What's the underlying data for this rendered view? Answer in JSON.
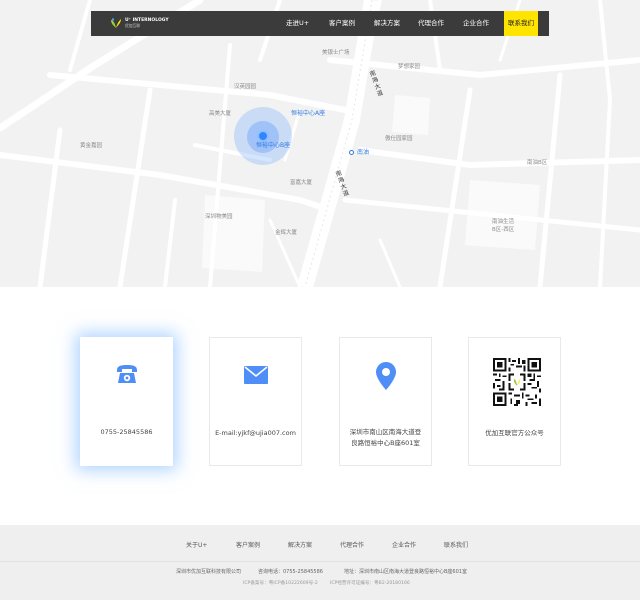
{
  "nav": {
    "logo_text": "U⁺ INTERNOLOGY",
    "logo_sub": "优加互联",
    "items": [
      {
        "label": "走进U+"
      },
      {
        "label": "客户案例"
      },
      {
        "label": "解决方案"
      },
      {
        "label": "代理合作"
      },
      {
        "label": "企业合作"
      },
      {
        "label": "联系我们",
        "active": true
      }
    ]
  },
  "map": {
    "labels": {
      "meiyinshi": "美银士广场",
      "mengxiang": "梦想家园",
      "hanying": "汉英园园",
      "gaomei": "高美大厦",
      "huangjin": "黄金嘉园",
      "hengyu_a": "恒裕中心A座",
      "hengyu_b": "恒裕中心B座",
      "youshi": "傲仕园家园",
      "nanyou": "南油",
      "nanyou_b": "南油B区",
      "fujia": "富嘉大厦",
      "shenzhen_meiyuan": "深圳物美园",
      "jinwei": "金辉大厦",
      "nanyou_shenghuo": "南油生活",
      "nanyou_shenghuo_2": "B区-西区",
      "road_north": "南海大道",
      "road_south": "南海大道"
    }
  },
  "contacts": {
    "phone": "0755-25845586",
    "email": "E-mail:yjkf@ujia007.com",
    "address_line1": "深圳市南山区南海大道登",
    "address_line2": "良路恒裕中心B座601室",
    "wechat": "优加互联官方公众号"
  },
  "icons": {
    "phone": "phone-icon",
    "email": "mail-icon",
    "location": "location-pin-icon",
    "qr": "qr-code-icon"
  },
  "colors": {
    "accent_blue": "#4f8ef7",
    "nav_bg": "#3b3b3b",
    "nav_active": "#ffe400"
  },
  "footer": {
    "links": [
      {
        "label": "关于U+"
      },
      {
        "label": "客户案例"
      },
      {
        "label": "解决方案"
      },
      {
        "label": "代理合作"
      },
      {
        "label": "企业合作"
      },
      {
        "label": "联系我们"
      }
    ],
    "company": "深圳市优加互联科技有限公司",
    "hotline": "咨询电话：0755-25845586",
    "address": "地址：深圳市南山区南海大道登良路恒裕中心B座601室",
    "icp1": "ICP备案号：粤ICP备10222609号-2",
    "icp2": "ICP经营许可证编号：粤B2-20180166"
  }
}
